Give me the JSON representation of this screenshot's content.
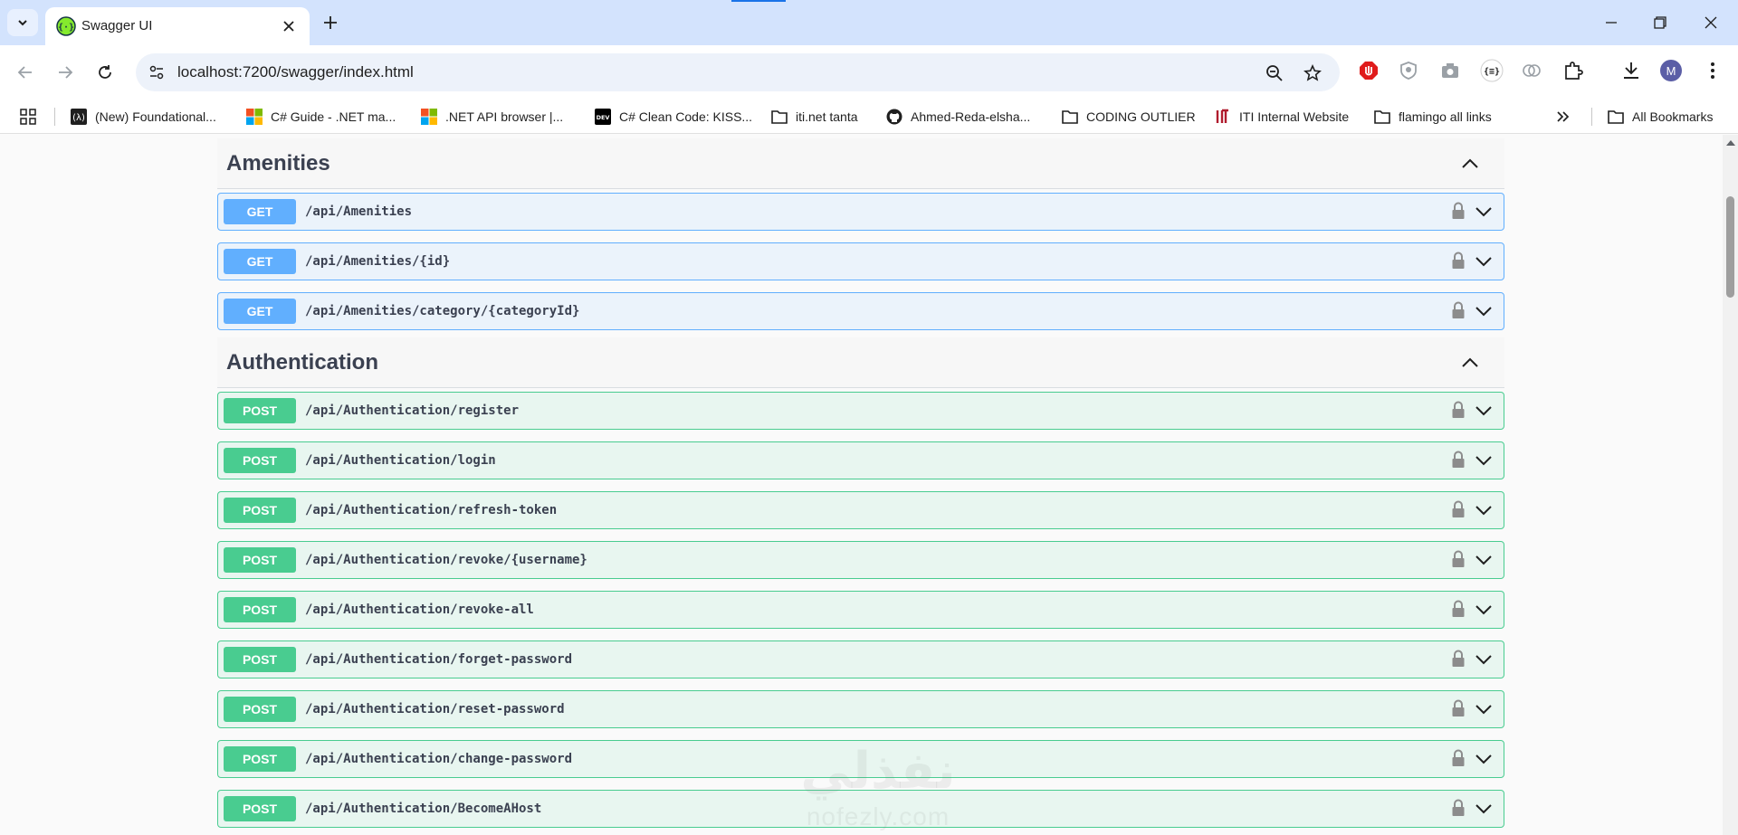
{
  "browser": {
    "tab": {
      "title": "Swagger UI",
      "favicon": "swagger-icon"
    },
    "address": {
      "url": "localhost:7200/swagger/index.html"
    },
    "avatar_initial": "M",
    "bookmarks": [
      {
        "label": "(New) Foundational...",
        "icon": "lambda-icon"
      },
      {
        "label": "C# Guide - .NET ma...",
        "icon": "microsoft-icon"
      },
      {
        "label": ".NET API browser |...",
        "icon": "microsoft-icon"
      },
      {
        "label": "C# Clean Code: KISS...",
        "icon": "dev-icon",
        "icon_text": "DEV"
      },
      {
        "label": "iti.net tanta",
        "icon": "folder-icon"
      },
      {
        "label": "Ahmed-Reda-elsha...",
        "icon": "github-icon"
      },
      {
        "label": "CODING OUTLIER",
        "icon": "folder-icon"
      },
      {
        "label": "ITI Internal Website",
        "icon": "iti-icon"
      },
      {
        "label": "flamingo all links",
        "icon": "folder-icon"
      }
    ],
    "all_bookmarks": "All Bookmarks"
  },
  "sections": [
    {
      "title": "Amenities",
      "operations": [
        {
          "method": "GET",
          "path": "/api/Amenities"
        },
        {
          "method": "GET",
          "path": "/api/Amenities/{id}"
        },
        {
          "method": "GET",
          "path": "/api/Amenities/category/{categoryId}"
        }
      ]
    },
    {
      "title": "Authentication",
      "operations": [
        {
          "method": "POST",
          "path": "/api/Authentication/register"
        },
        {
          "method": "POST",
          "path": "/api/Authentication/login"
        },
        {
          "method": "POST",
          "path": "/api/Authentication/refresh-token"
        },
        {
          "method": "POST",
          "path": "/api/Authentication/revoke/{username}"
        },
        {
          "method": "POST",
          "path": "/api/Authentication/revoke-all"
        },
        {
          "method": "POST",
          "path": "/api/Authentication/forget-password"
        },
        {
          "method": "POST",
          "path": "/api/Authentication/reset-password"
        },
        {
          "method": "POST",
          "path": "/api/Authentication/change-password"
        },
        {
          "method": "POST",
          "path": "/api/Authentication/BecomeAHost"
        }
      ]
    }
  ],
  "watermark": {
    "arabic": "نفذلي",
    "latin": "nofezly.com"
  },
  "colors": {
    "get": "#61affe",
    "post": "#49cc90",
    "tabstrip": "#d3e3fd"
  }
}
